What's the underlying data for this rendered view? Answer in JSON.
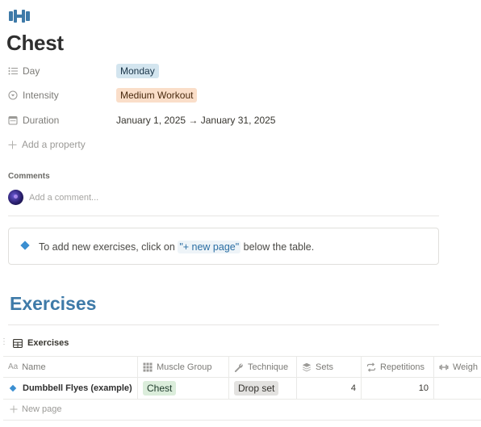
{
  "page": {
    "icon": "dumbbell-icon",
    "title": "Chest"
  },
  "properties": [
    {
      "label": "Day",
      "icon": "list-icon",
      "value": "Monday",
      "type": "tag",
      "color": "#d3e5ef"
    },
    {
      "label": "Intensity",
      "icon": "select-icon",
      "value": "Medium Workout",
      "type": "tag",
      "color": "#fadec9"
    },
    {
      "label": "Duration",
      "icon": "calendar-icon",
      "value": "January 1, 2025 → January 31, 2025",
      "type": "text"
    }
  ],
  "add_property": "Add a property",
  "comments": {
    "heading": "Comments",
    "placeholder": "Add a comment..."
  },
  "callout": {
    "prefix": "To add new exercises, click on ",
    "code": "\"+ new page\"",
    "suffix": " below the table."
  },
  "section_heading": "Exercises",
  "database": {
    "title": "Exercises",
    "columns": [
      {
        "label": "Name",
        "icon": "aa-icon"
      },
      {
        "label": "Muscle Group",
        "icon": "grid-icon"
      },
      {
        "label": "Technique",
        "icon": "wrench-icon"
      },
      {
        "label": "Sets",
        "icon": "layers-icon"
      },
      {
        "label": "Repetitions",
        "icon": "repeat-icon"
      },
      {
        "label": "Weigh",
        "icon": "dumbbell-icon"
      }
    ],
    "rows": [
      {
        "name": "Dumbbell Flyes (example)",
        "muscle_group": "Chest",
        "technique": "Drop set",
        "sets": "4",
        "repetitions": "10",
        "weight": ""
      }
    ],
    "new_page": "New page"
  },
  "colors": {
    "accent_blue": "#3e7aa8",
    "callout_icon": "#3b8fd1"
  }
}
